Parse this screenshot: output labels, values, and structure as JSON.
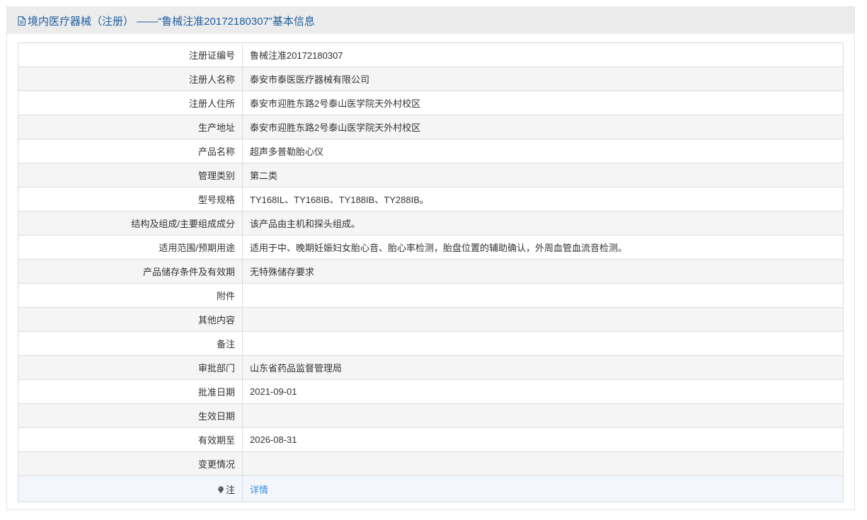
{
  "header": {
    "title": "境内医疗器械（注册） ——“鲁械注准20172180307”基本信息",
    "icon": "document-icon"
  },
  "rows": [
    {
      "label": "注册证编号",
      "value": "鲁械注准20172180307"
    },
    {
      "label": "注册人名称",
      "value": "泰安市泰医医疗器械有限公司"
    },
    {
      "label": "注册人住所",
      "value": "泰安市迎胜东路2号泰山医学院天外村校区"
    },
    {
      "label": "生产地址",
      "value": "泰安市迎胜东路2号泰山医学院天外村校区"
    },
    {
      "label": "产品名称",
      "value": "超声多普勒胎心仪"
    },
    {
      "label": "管理类别",
      "value": "第二类"
    },
    {
      "label": "型号规格",
      "value": "TY168IL、TY168IB、TY188IB、TY288IB。"
    },
    {
      "label": "结构及组成/主要组成成分",
      "value": "该产品由主机和探头组成。"
    },
    {
      "label": "适用范围/预期用途",
      "value": "适用于中、晚期妊娠妇女胎心音、胎心率检测，胎盘位置的辅助确认，外周血管血流音检测。"
    },
    {
      "label": "产品储存条件及有效期",
      "value": "无特殊储存要求"
    },
    {
      "label": "附件",
      "value": ""
    },
    {
      "label": "其他内容",
      "value": ""
    },
    {
      "label": "备注",
      "value": ""
    },
    {
      "label": "审批部门",
      "value": "山东省药品监督管理局"
    },
    {
      "label": "批准日期",
      "value": "2021-09-01"
    },
    {
      "label": "生效日期",
      "value": ""
    },
    {
      "label": "有效期至",
      "value": "2026-08-31"
    },
    {
      "label": "变更情况",
      "value": ""
    }
  ],
  "note": {
    "label": "注",
    "icon": "pin-icon",
    "link_text": "详情"
  },
  "colors": {
    "header_text": "#1f5e9e",
    "header_bg": "#ececec",
    "link": "#3a8ee6",
    "alt_row_bg": "#f5f5f5"
  }
}
